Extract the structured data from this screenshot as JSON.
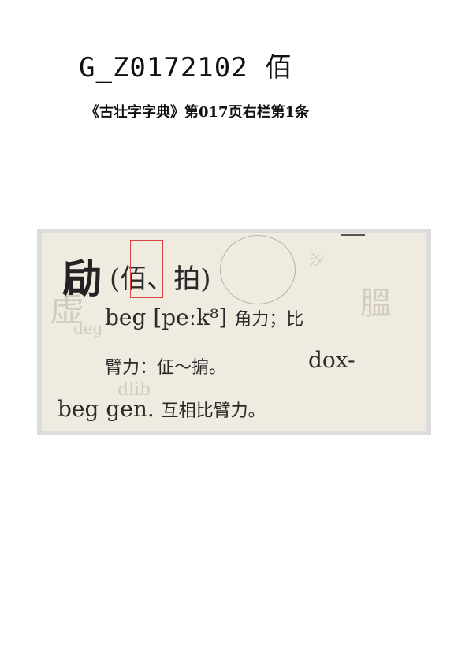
{
  "header": {
    "code": "G_Z0172102",
    "character": "佰"
  },
  "source": {
    "citation": "《古壮字字典》第017页右栏第1条"
  },
  "scan": {
    "headword": "劶",
    "variants": "(佰、拍)",
    "line2_roman": "beg [peːk⁸]",
    "line2_gloss": "角力；比",
    "line3_gloss": "臂力：佂～掮。",
    "line3_roman": "dox-",
    "line4_roman": "beg gen.",
    "line4_gloss": "互相比臂力。",
    "highlight_color": "#d9443e"
  }
}
